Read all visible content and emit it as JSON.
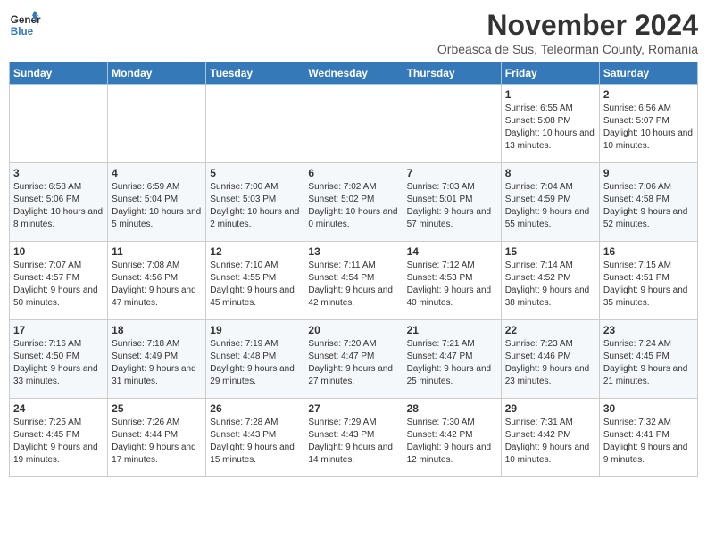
{
  "logo": {
    "line1": "General",
    "line2": "Blue"
  },
  "header": {
    "month_year": "November 2024",
    "location": "Orbeasca de Sus, Teleorman County, Romania"
  },
  "weekdays": [
    "Sunday",
    "Monday",
    "Tuesday",
    "Wednesday",
    "Thursday",
    "Friday",
    "Saturday"
  ],
  "weeks": [
    [
      {
        "day": "",
        "content": ""
      },
      {
        "day": "",
        "content": ""
      },
      {
        "day": "",
        "content": ""
      },
      {
        "day": "",
        "content": ""
      },
      {
        "day": "",
        "content": ""
      },
      {
        "day": "1",
        "content": "Sunrise: 6:55 AM\nSunset: 5:08 PM\nDaylight: 10 hours and 13 minutes."
      },
      {
        "day": "2",
        "content": "Sunrise: 6:56 AM\nSunset: 5:07 PM\nDaylight: 10 hours and 10 minutes."
      }
    ],
    [
      {
        "day": "3",
        "content": "Sunrise: 6:58 AM\nSunset: 5:06 PM\nDaylight: 10 hours and 8 minutes."
      },
      {
        "day": "4",
        "content": "Sunrise: 6:59 AM\nSunset: 5:04 PM\nDaylight: 10 hours and 5 minutes."
      },
      {
        "day": "5",
        "content": "Sunrise: 7:00 AM\nSunset: 5:03 PM\nDaylight: 10 hours and 2 minutes."
      },
      {
        "day": "6",
        "content": "Sunrise: 7:02 AM\nSunset: 5:02 PM\nDaylight: 10 hours and 0 minutes."
      },
      {
        "day": "7",
        "content": "Sunrise: 7:03 AM\nSunset: 5:01 PM\nDaylight: 9 hours and 57 minutes."
      },
      {
        "day": "8",
        "content": "Sunrise: 7:04 AM\nSunset: 4:59 PM\nDaylight: 9 hours and 55 minutes."
      },
      {
        "day": "9",
        "content": "Sunrise: 7:06 AM\nSunset: 4:58 PM\nDaylight: 9 hours and 52 minutes."
      }
    ],
    [
      {
        "day": "10",
        "content": "Sunrise: 7:07 AM\nSunset: 4:57 PM\nDaylight: 9 hours and 50 minutes."
      },
      {
        "day": "11",
        "content": "Sunrise: 7:08 AM\nSunset: 4:56 PM\nDaylight: 9 hours and 47 minutes."
      },
      {
        "day": "12",
        "content": "Sunrise: 7:10 AM\nSunset: 4:55 PM\nDaylight: 9 hours and 45 minutes."
      },
      {
        "day": "13",
        "content": "Sunrise: 7:11 AM\nSunset: 4:54 PM\nDaylight: 9 hours and 42 minutes."
      },
      {
        "day": "14",
        "content": "Sunrise: 7:12 AM\nSunset: 4:53 PM\nDaylight: 9 hours and 40 minutes."
      },
      {
        "day": "15",
        "content": "Sunrise: 7:14 AM\nSunset: 4:52 PM\nDaylight: 9 hours and 38 minutes."
      },
      {
        "day": "16",
        "content": "Sunrise: 7:15 AM\nSunset: 4:51 PM\nDaylight: 9 hours and 35 minutes."
      }
    ],
    [
      {
        "day": "17",
        "content": "Sunrise: 7:16 AM\nSunset: 4:50 PM\nDaylight: 9 hours and 33 minutes."
      },
      {
        "day": "18",
        "content": "Sunrise: 7:18 AM\nSunset: 4:49 PM\nDaylight: 9 hours and 31 minutes."
      },
      {
        "day": "19",
        "content": "Sunrise: 7:19 AM\nSunset: 4:48 PM\nDaylight: 9 hours and 29 minutes."
      },
      {
        "day": "20",
        "content": "Sunrise: 7:20 AM\nSunset: 4:47 PM\nDaylight: 9 hours and 27 minutes."
      },
      {
        "day": "21",
        "content": "Sunrise: 7:21 AM\nSunset: 4:47 PM\nDaylight: 9 hours and 25 minutes."
      },
      {
        "day": "22",
        "content": "Sunrise: 7:23 AM\nSunset: 4:46 PM\nDaylight: 9 hours and 23 minutes."
      },
      {
        "day": "23",
        "content": "Sunrise: 7:24 AM\nSunset: 4:45 PM\nDaylight: 9 hours and 21 minutes."
      }
    ],
    [
      {
        "day": "24",
        "content": "Sunrise: 7:25 AM\nSunset: 4:45 PM\nDaylight: 9 hours and 19 minutes."
      },
      {
        "day": "25",
        "content": "Sunrise: 7:26 AM\nSunset: 4:44 PM\nDaylight: 9 hours and 17 minutes."
      },
      {
        "day": "26",
        "content": "Sunrise: 7:28 AM\nSunset: 4:43 PM\nDaylight: 9 hours and 15 minutes."
      },
      {
        "day": "27",
        "content": "Sunrise: 7:29 AM\nSunset: 4:43 PM\nDaylight: 9 hours and 14 minutes."
      },
      {
        "day": "28",
        "content": "Sunrise: 7:30 AM\nSunset: 4:42 PM\nDaylight: 9 hours and 12 minutes."
      },
      {
        "day": "29",
        "content": "Sunrise: 7:31 AM\nSunset: 4:42 PM\nDaylight: 9 hours and 10 minutes."
      },
      {
        "day": "30",
        "content": "Sunrise: 7:32 AM\nSunset: 4:41 PM\nDaylight: 9 hours and 9 minutes."
      }
    ]
  ]
}
